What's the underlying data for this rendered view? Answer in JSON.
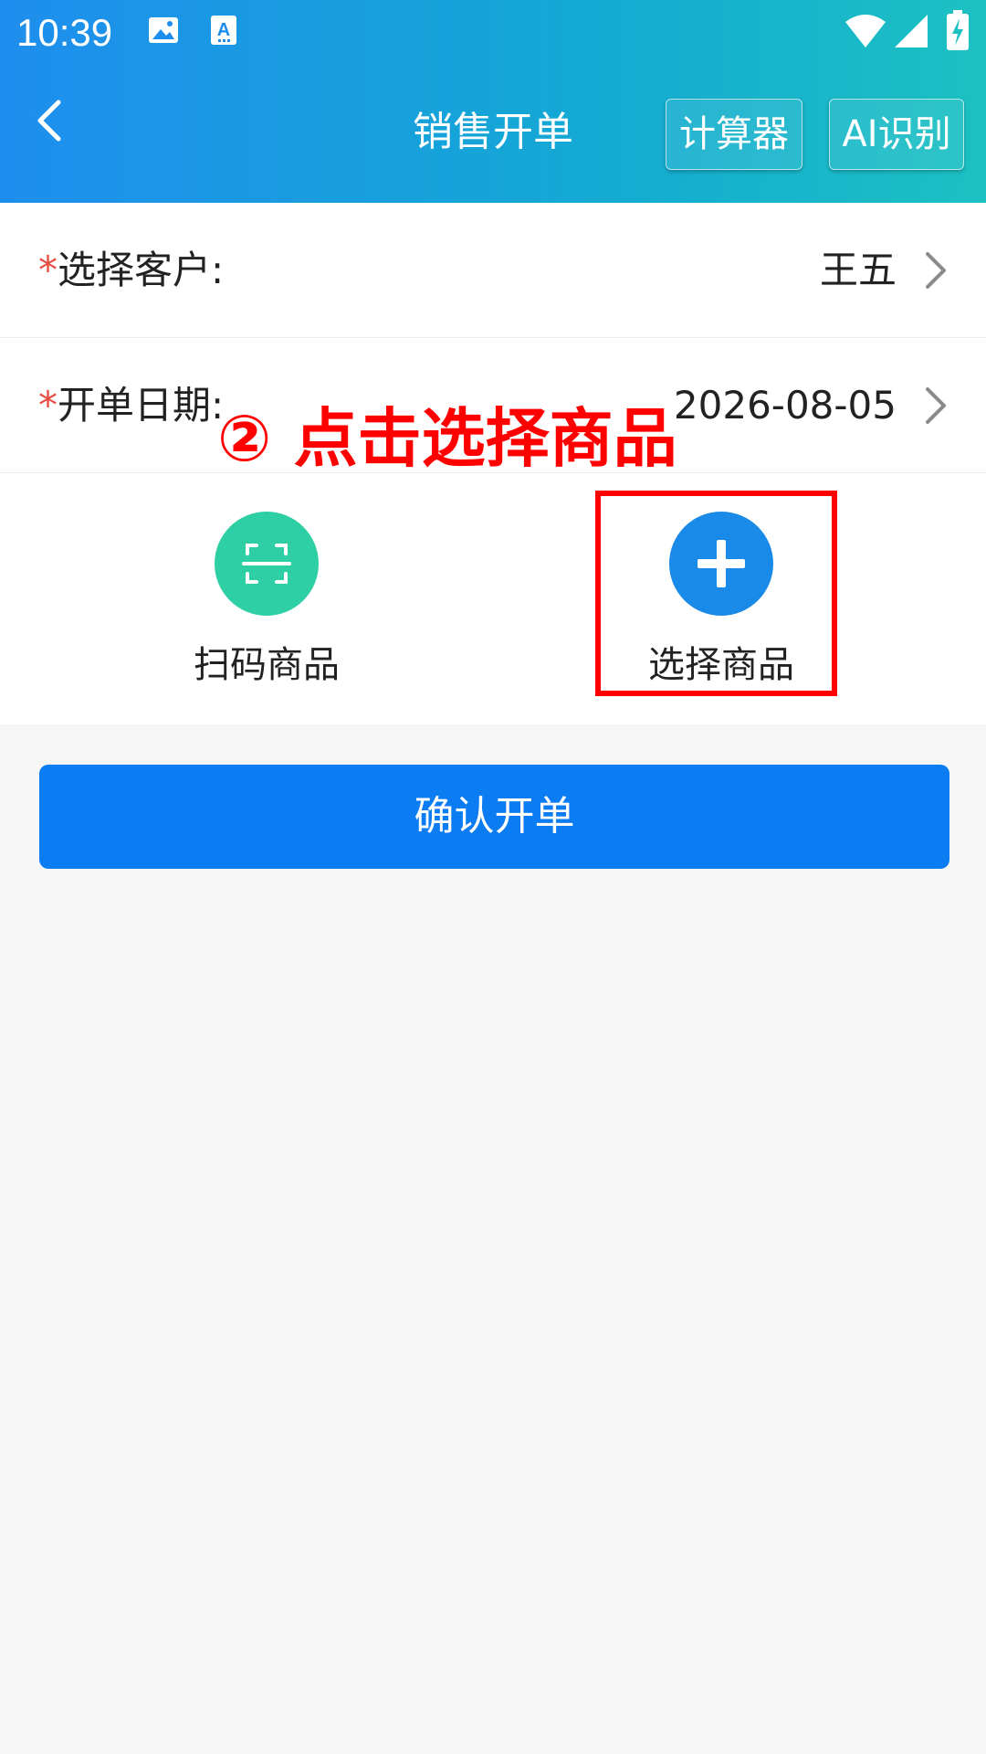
{
  "status_bar": {
    "time": "10:39",
    "icons": [
      "image-icon",
      "text-a-icon",
      "wifi-icon",
      "signal-icon",
      "battery-charging-icon"
    ]
  },
  "header": {
    "title": "销售开单",
    "calculator_label": "计算器",
    "ai_label": "AI识别",
    "back_icon": "chevron-left-icon"
  },
  "form": {
    "customer": {
      "required": "*",
      "label": "选择客户:",
      "value": "王五"
    },
    "date": {
      "required": "*",
      "label": "开单日期:",
      "value": "2026-08-05"
    }
  },
  "actions": {
    "scan": {
      "label": "扫码商品",
      "icon": "scan-icon"
    },
    "select": {
      "label": "选择商品",
      "icon": "plus-icon"
    }
  },
  "annotation": {
    "text": "② 点击选择商品"
  },
  "confirm": {
    "label": "确认开单"
  },
  "colors": {
    "header_gradient_start": "#1e8eee",
    "header_gradient_end": "#1cc1c2",
    "primary_button": "#0b7cf2",
    "scan_circle": "#2ecfa4",
    "select_circle": "#1a8ae8",
    "required_mark": "#e54d42",
    "annotation": "#ff0000"
  }
}
